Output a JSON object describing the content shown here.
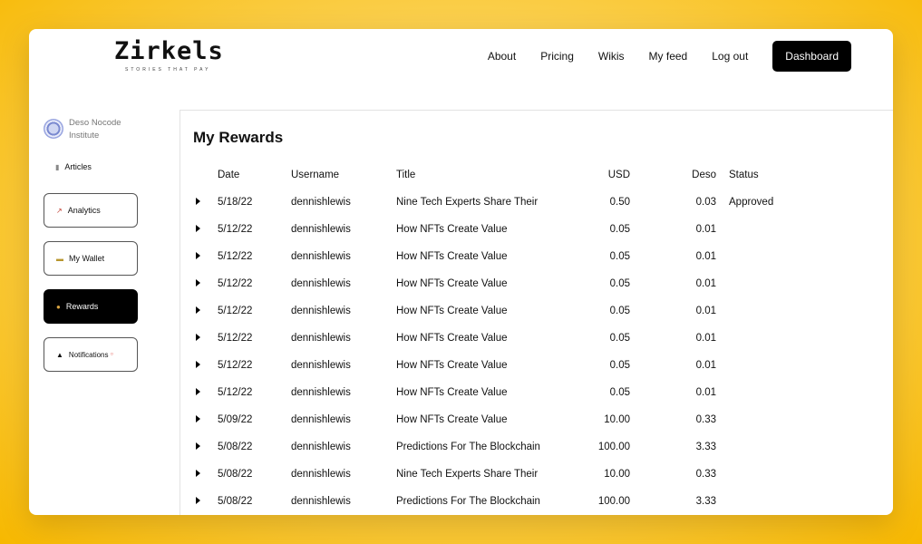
{
  "header": {
    "logo_text": "Zirkels",
    "tagline": "STORIES THAT PAY",
    "nav": [
      "About",
      "Pricing",
      "Wikis",
      "My feed",
      "Log out"
    ],
    "dashboard_label": "Dashboard"
  },
  "sidebar": {
    "profile_name": "Deso Nocode Institute",
    "articles_label": "Articles",
    "items": [
      {
        "label": "Analytics",
        "icon": "chart-icon"
      },
      {
        "label": "My Wallet",
        "icon": "card-icon"
      },
      {
        "label": "Rewards",
        "icon": "money-bag-icon"
      },
      {
        "label": "Notifications",
        "icon": "bell-icon"
      }
    ]
  },
  "main": {
    "title": "My Rewards",
    "columns": [
      "Date",
      "Username",
      "Title",
      "USD",
      "Deso",
      "Status"
    ],
    "rows": [
      {
        "date": "5/18/22",
        "username": "dennishlewis",
        "title": "Nine Tech Experts Share Their",
        "usd": "0.50",
        "deso": "0.03",
        "status": "Approved"
      },
      {
        "date": "5/12/22",
        "username": "dennishlewis",
        "title": "How NFTs Create Value",
        "usd": "0.05",
        "deso": "0.01",
        "status": ""
      },
      {
        "date": "5/12/22",
        "username": "dennishlewis",
        "title": "How NFTs Create Value",
        "usd": "0.05",
        "deso": "0.01",
        "status": ""
      },
      {
        "date": "5/12/22",
        "username": "dennishlewis",
        "title": "How NFTs Create Value",
        "usd": "0.05",
        "deso": "0.01",
        "status": ""
      },
      {
        "date": "5/12/22",
        "username": "dennishlewis",
        "title": "How NFTs Create Value",
        "usd": "0.05",
        "deso": "0.01",
        "status": ""
      },
      {
        "date": "5/12/22",
        "username": "dennishlewis",
        "title": "How NFTs Create Value",
        "usd": "0.05",
        "deso": "0.01",
        "status": ""
      },
      {
        "date": "5/12/22",
        "username": "dennishlewis",
        "title": "How NFTs Create Value",
        "usd": "0.05",
        "deso": "0.01",
        "status": ""
      },
      {
        "date": "5/12/22",
        "username": "dennishlewis",
        "title": "How NFTs Create Value",
        "usd": "0.05",
        "deso": "0.01",
        "status": ""
      },
      {
        "date": "5/09/22",
        "username": "dennishlewis",
        "title": "How NFTs Create Value",
        "usd": "10.00",
        "deso": "0.33",
        "status": ""
      },
      {
        "date": "5/08/22",
        "username": "dennishlewis",
        "title": "Predictions For The Blockchain",
        "usd": "100.00",
        "deso": "3.33",
        "status": ""
      },
      {
        "date": "5/08/22",
        "username": "dennishlewis",
        "title": "Nine Tech Experts Share Their",
        "usd": "10.00",
        "deso": "0.33",
        "status": ""
      },
      {
        "date": "5/08/22",
        "username": "dennishlewis",
        "title": "Predictions For The Blockchain",
        "usd": "100.00",
        "deso": "3.33",
        "status": ""
      }
    ]
  }
}
